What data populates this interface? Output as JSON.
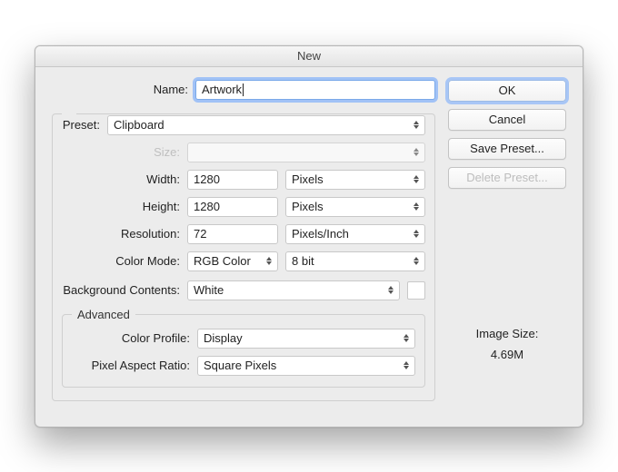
{
  "window": {
    "title": "New"
  },
  "labels": {
    "name": "Name:",
    "preset": "Preset:",
    "size": "Size:",
    "width": "Width:",
    "height": "Height:",
    "resolution": "Resolution:",
    "color_mode": "Color Mode:",
    "background_contents": "Background Contents:",
    "advanced": "Advanced",
    "color_profile": "Color Profile:",
    "pixel_aspect_ratio": "Pixel Aspect Ratio:"
  },
  "values": {
    "name": "Artwork",
    "preset": "Clipboard",
    "size": "",
    "width": "1280",
    "width_unit": "Pixels",
    "height": "1280",
    "height_unit": "Pixels",
    "resolution": "72",
    "resolution_unit": "Pixels/Inch",
    "color_mode": "RGB Color",
    "color_depth": "8 bit",
    "background_contents": "White",
    "color_profile": "Display",
    "pixel_aspect_ratio": "Square Pixels"
  },
  "side": {
    "ok": "OK",
    "cancel": "Cancel",
    "save_preset": "Save Preset...",
    "delete_preset": "Delete Preset...",
    "image_size_label": "Image Size:",
    "image_size_value": "4.69M"
  }
}
